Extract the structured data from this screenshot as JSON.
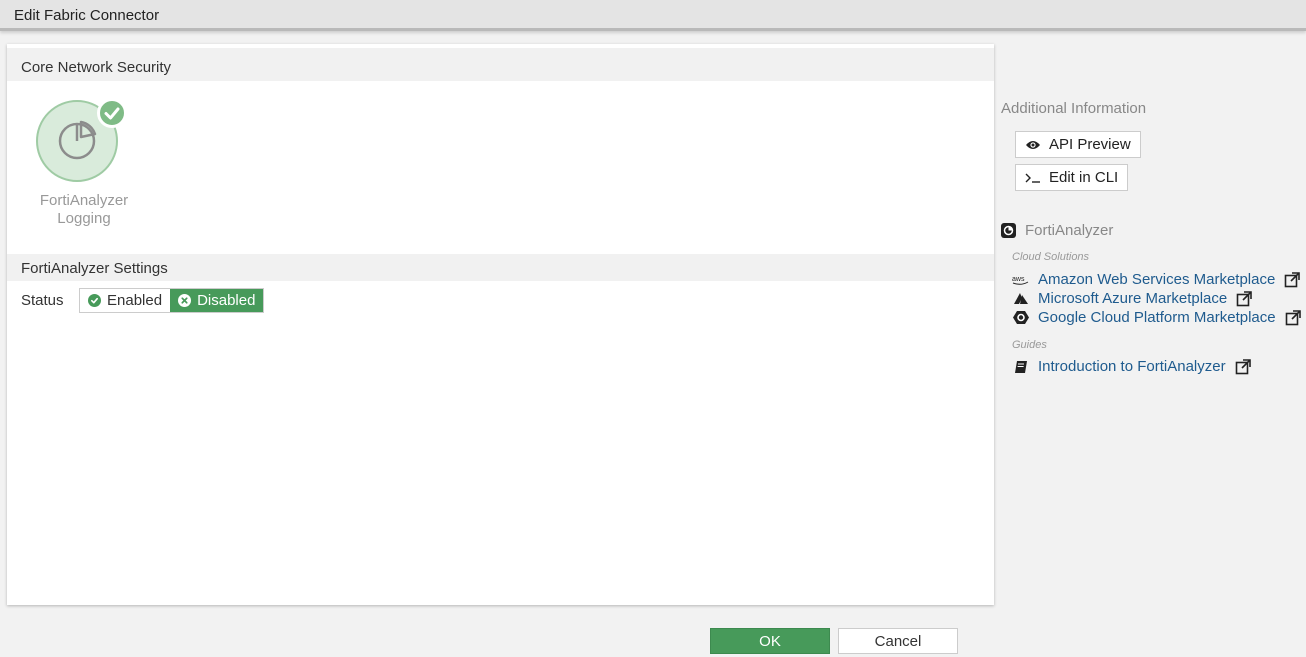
{
  "window": {
    "title": "Edit Fabric Connector"
  },
  "sections": {
    "core": {
      "title": "Core Network Security"
    },
    "settings": {
      "title": "FortiAnalyzer Settings"
    }
  },
  "tile": {
    "label_line1": "FortiAnalyzer",
    "label_line2": "Logging",
    "icon": "pie-chart-icon",
    "accent": "#7fbb86"
  },
  "status": {
    "label": "Status",
    "enabled_label": "Enabled",
    "disabled_label": "Disabled",
    "selected": "Disabled",
    "accent": "#479a5a"
  },
  "sidebar": {
    "title": "Additional Information",
    "api_preview": "API Preview",
    "edit_cli": "Edit in CLI",
    "product": "FortiAnalyzer",
    "cloud_label": "Cloud Solutions",
    "links": [
      {
        "label": "Amazon Web Services Marketplace",
        "icon": "aws-icon"
      },
      {
        "label": "Microsoft Azure Marketplace",
        "icon": "azure-icon"
      },
      {
        "label": "Google Cloud Platform Marketplace",
        "icon": "gcp-icon"
      }
    ],
    "guides_label": "Guides",
    "guide": {
      "label": "Introduction to FortiAnalyzer",
      "icon": "book-icon"
    },
    "link_color": "#1f5b8e"
  },
  "footer": {
    "ok": "OK",
    "cancel": "Cancel"
  }
}
